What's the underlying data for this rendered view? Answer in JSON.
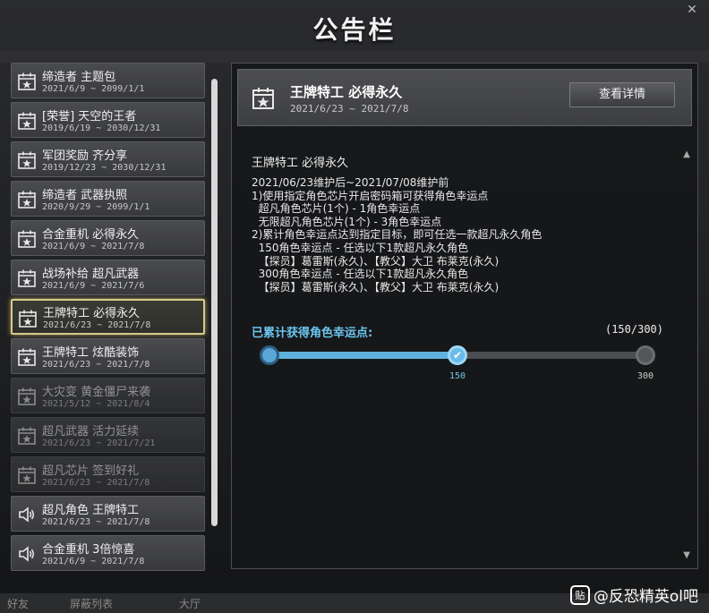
{
  "window": {
    "title": "公告栏",
    "close_label": "✕"
  },
  "bottom_bar": {
    "left": "好友",
    "mid": "屏蔽列表",
    "right": "大厅"
  },
  "list": [
    {
      "name": "缔造者 主题包",
      "date": "2021/6/9 ~ 2099/1/1",
      "icon": "calendar-star-icon",
      "state": "normal"
    },
    {
      "name": "[荣誉] 天空的王者",
      "date": "2019/6/19 ~ 2030/12/31",
      "icon": "calendar-star-icon",
      "state": "normal"
    },
    {
      "name": "军团奖励 齐分享",
      "date": "2019/12/23 ~ 2030/12/31",
      "icon": "calendar-star-icon",
      "state": "normal"
    },
    {
      "name": "缔造者 武器执照",
      "date": "2020/9/29 ~ 2099/1/1",
      "icon": "calendar-star-icon",
      "state": "normal"
    },
    {
      "name": "合金重机 必得永久",
      "date": "2021/6/9 ~ 2021/7/8",
      "icon": "calendar-star-icon",
      "state": "normal"
    },
    {
      "name": "战场补给 超凡武器",
      "date": "2021/6/9 ~ 2021/7/6",
      "icon": "calendar-star-icon",
      "state": "normal"
    },
    {
      "name": "王牌特工 必得永久",
      "date": "2021/6/23 ~ 2021/7/8",
      "icon": "calendar-star-icon",
      "state": "selected"
    },
    {
      "name": "王牌特工 炫酷装饰",
      "date": "2021/6/23 ~ 2021/7/8",
      "icon": "calendar-star-icon",
      "state": "normal"
    },
    {
      "name": "大灾变 黄金僵尸来袭",
      "date": "2021/5/12 ~ 2021/8/4",
      "icon": "calendar-star-icon",
      "state": "dim"
    },
    {
      "name": "超凡武器 活力延续",
      "date": "2021/6/23 ~ 2021/7/21",
      "icon": "calendar-star-icon",
      "state": "dim"
    },
    {
      "name": "超凡芯片 签到好礼",
      "date": "2021/6/23 ~ 2021/7/8",
      "icon": "calendar-star-icon",
      "state": "dim"
    },
    {
      "name": "超凡角色 王牌特工",
      "date": "2021/6/23 ~ 2021/7/8",
      "icon": "speaker-icon",
      "state": "normal"
    },
    {
      "name": "合金重机 3倍惊喜",
      "date": "2021/6/9 ~ 2021/7/8",
      "icon": "speaker-icon",
      "state": "normal"
    }
  ],
  "detail": {
    "title": "王牌特工 必得永久",
    "date": "2021/6/23 ~ 2021/7/8",
    "button": "查看详情",
    "body_title": "王牌特工 必得永久",
    "body": "2021/06/23维护后~2021/07/08维护前\n1)使用指定角色芯片开启密码箱可获得角色幸运点\n  超凡角色芯片(1个) - 1角色幸运点\n  无限超凡角色芯片(1个) - 3角色幸运点\n2)累计角色幸运点达到指定目标，即可任选一款超凡永久角色\n  150角色幸运点 - 任选以下1款超凡永久角色\n  【探员】葛雷斯(永久)、【教父】大卫 布莱克(永久)\n  300角色幸运点 - 任选以下1款超凡永久角色\n  【探员】葛雷斯(永久)、【教父】大卫 布莱克(永久)",
    "progress": {
      "label": "已累计获得角色幸运点:",
      "count_text": "(150/300)",
      "current": 150,
      "max": 300,
      "milestones": [
        "150",
        "300"
      ],
      "mid_check": "✔"
    }
  },
  "watermark": {
    "logo": "贴",
    "text": "@反恐精英ol吧"
  },
  "colors": {
    "accent": "#5fb2df",
    "selected_border": "#d9c98a"
  }
}
